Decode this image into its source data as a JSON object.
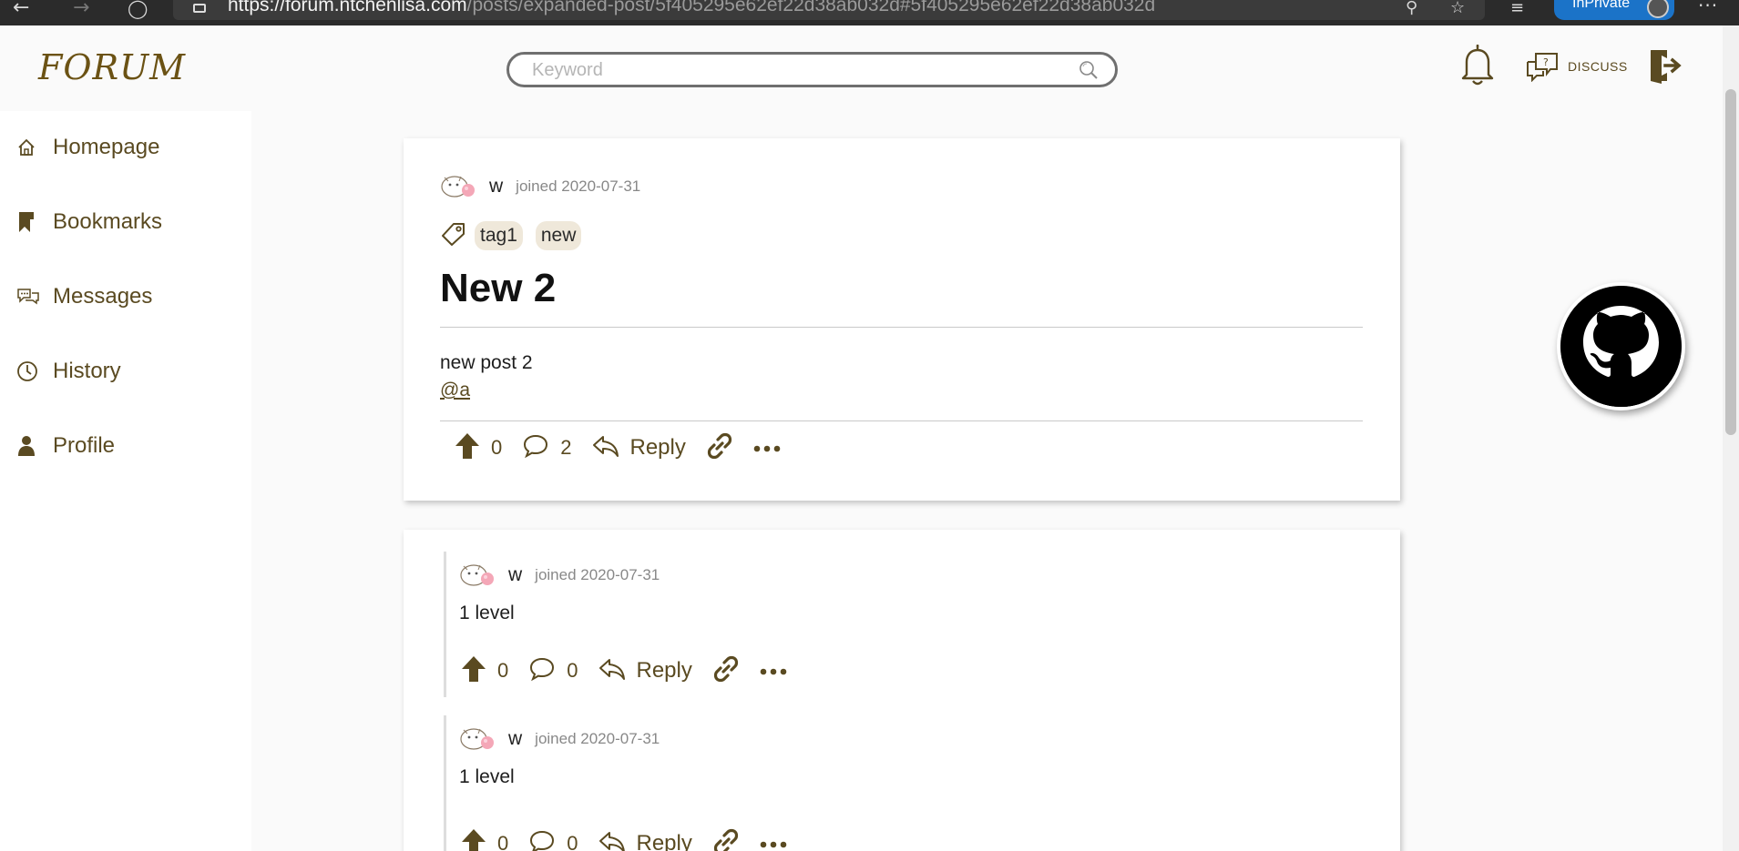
{
  "browser": {
    "url_host": "https://forum.ntchenlisa.com",
    "url_path": "/posts/expanded-post/5f405295e62ef22d38ab032d#5f405295e62ef22d38ab032d",
    "inprivate_label": "InPrivate"
  },
  "header": {
    "logo": "FORUM",
    "search_placeholder": "Keyword",
    "discuss_label": "DISCUSS"
  },
  "sidebar": {
    "items": [
      {
        "label": "Homepage",
        "icon": "home-icon"
      },
      {
        "label": "Bookmarks",
        "icon": "bookmark-icon"
      },
      {
        "label": "Messages",
        "icon": "messages-icon"
      },
      {
        "label": "History",
        "icon": "clock-icon"
      },
      {
        "label": "Profile",
        "icon": "user-icon"
      }
    ]
  },
  "post": {
    "author": "w",
    "joined": "joined 2020-07-31",
    "tags": [
      "tag1",
      "new"
    ],
    "title": "New 2",
    "body": "new post 2",
    "mention": "@a",
    "upvotes": "0",
    "comments": "2",
    "reply_label": "Reply"
  },
  "comments": [
    {
      "author": "w",
      "joined": "joined 2020-07-31",
      "text": "1 level",
      "upvotes": "0",
      "comments": "0",
      "reply_label": "Reply"
    },
    {
      "author": "w",
      "joined": "joined 2020-07-31",
      "text": "1 level",
      "upvotes": "0",
      "comments": "0",
      "reply_label": "Reply"
    }
  ],
  "colors": {
    "brand": "#6b5214",
    "icon": "#5a4a21",
    "tag_bg": "#efe8da"
  }
}
